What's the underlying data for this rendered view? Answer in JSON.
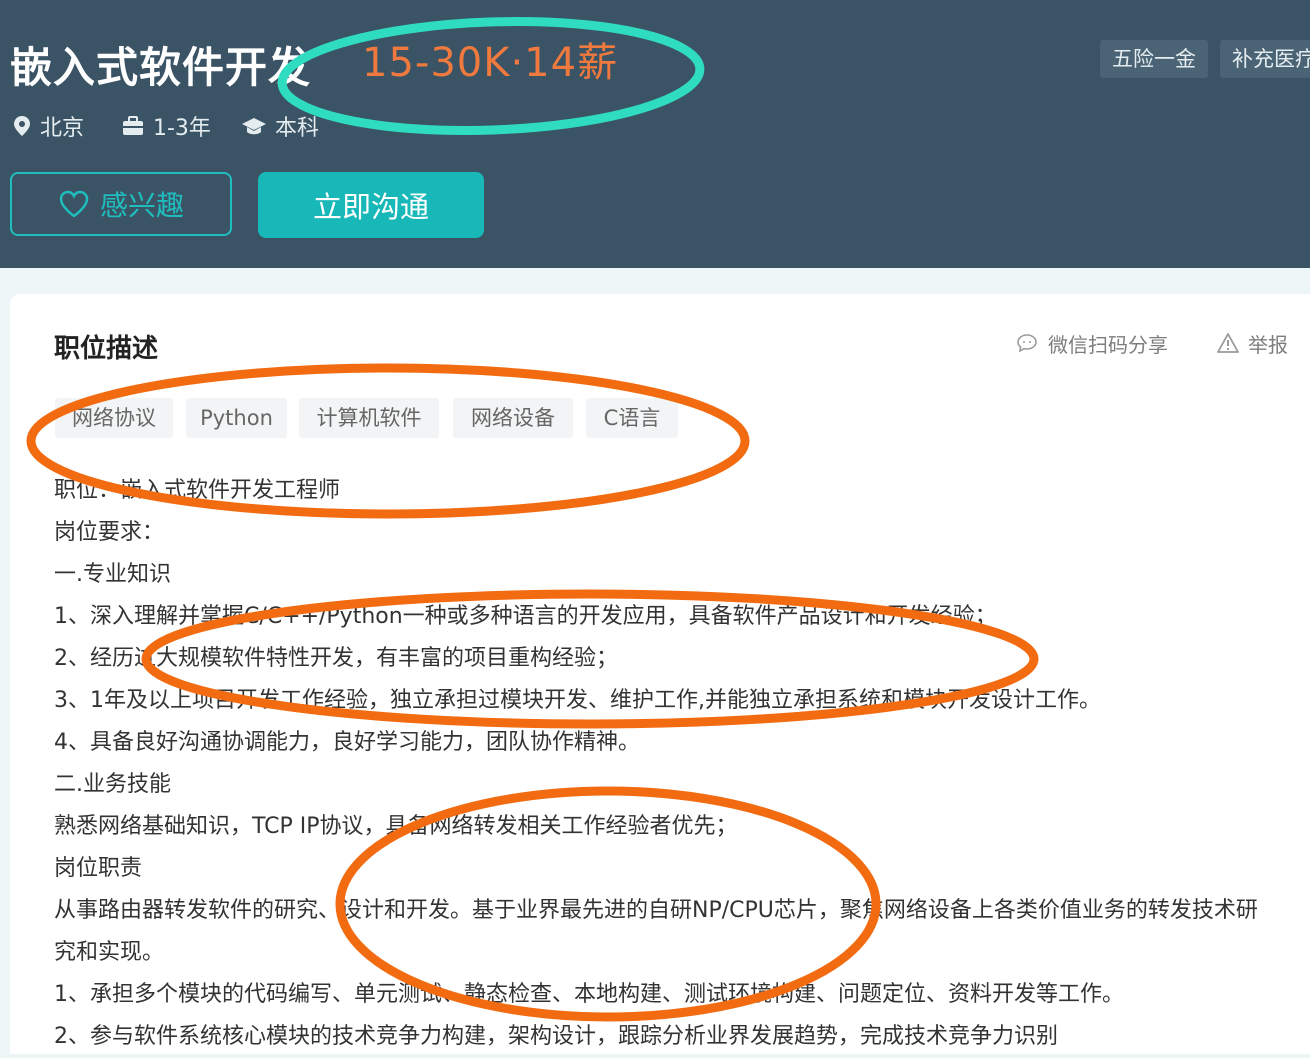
{
  "job": {
    "title": "嵌入式软件开发",
    "salary": "15-30K·14薪",
    "welfare": [
      "五险一金",
      "补充医疗"
    ],
    "location": "北京",
    "experience": "1-3年",
    "education": "本科"
  },
  "actions": {
    "interest_label": "感兴趣",
    "chat_label": "立即沟通"
  },
  "section": {
    "title": "职位描述",
    "share_label": "微信扫码分享",
    "report_label": "举报"
  },
  "tags": [
    "网络协议",
    "Python",
    "计算机软件",
    "网络设备",
    "C语言"
  ],
  "description": [
    "职位：嵌入式软件开发工程师",
    "岗位要求：",
    "一.专业知识",
    "1、深入理解并掌握C/C++/Python一种或多种语言的开发应用，具备软件产品设计和开发经验；",
    "2、经历过大规模软件特性开发，有丰富的项目重构经验；",
    "3、1年及以上项目开发工作经验，独立承担过模块开发、维护工作,并能独立承担系统和模块开发设计工作。",
    "4、具备良好沟通协调能力，良好学习能力，团队协作精神。",
    "二.业务技能",
    "熟悉网络基础知识，TCP IP协议，具备网络转发相关工作经验者优先；",
    "岗位职责",
    "从事路由器转发软件的研究、设计和开发。基于业界最先进的自研NP/CPU芯片，聚焦网络设备上各类价值业务的转发技术研",
    "究和实现。",
    "1、承担多个模块的代码编写、单元测试、静态检查、本地构建、测试环境构建、问题定位、资料开发等工作。",
    "2、参与软件系统核心模块的技术竞争力构建，架构设计，跟踪分析业界发展趋势，完成技术竞争力识别"
  ],
  "colors": {
    "header_bg": "#3a5365",
    "accent_teal": "#19b8b8",
    "salary_orange": "#f07a3e",
    "annotation_orange": "#f26b10",
    "annotation_mint": "#2fdcc0"
  }
}
